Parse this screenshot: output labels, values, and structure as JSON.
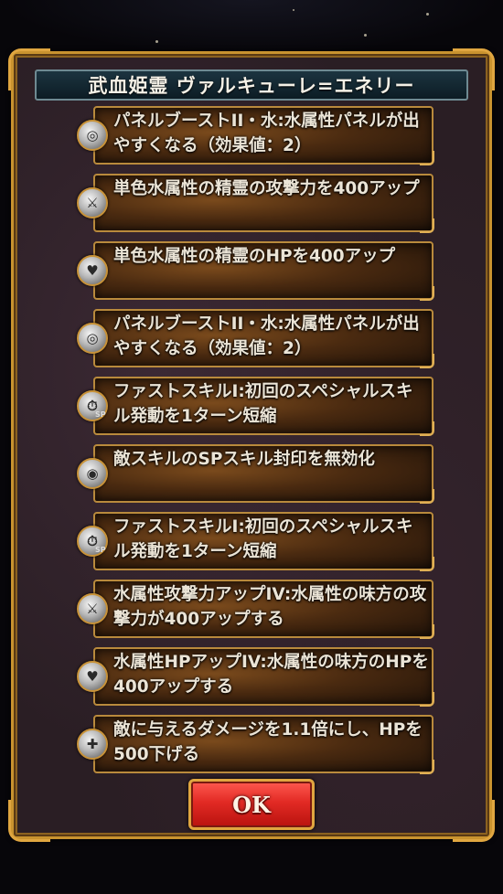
{
  "dialog": {
    "title": "武血姫霊 ヴァルキューレ=エネリー",
    "ok_label": "OK"
  },
  "skills": [
    {
      "icon": "swirl-icon",
      "text": "パネルブーストII・水:水属性パネルが出やすくなる（効果値：2）"
    },
    {
      "icon": "swords-icon",
      "text": "単色水属性の精霊の攻撃力を400アップ"
    },
    {
      "icon": "heart-icon",
      "text": "単色水属性の精霊のHPを400アップ"
    },
    {
      "icon": "swirl-icon",
      "text": "パネルブーストII・水:水属性パネルが出やすくなる（効果値：2）"
    },
    {
      "icon": "fast-skill-icon",
      "sp": "SP",
      "text": "ファストスキルI:初回のスペシャルスキル発動を1ターン短縮"
    },
    {
      "icon": "shield-icon",
      "text": "敵スキルのSPスキル封印を無効化"
    },
    {
      "icon": "fast-skill-icon",
      "sp": "SP",
      "text": "ファストスキルI:初回のスペシャルスキル発動を1ターン短縮"
    },
    {
      "icon": "swords-icon",
      "text": "水属性攻撃力アップIV:水属性の味方の攻撃力が400アップする"
    },
    {
      "icon": "heart-icon",
      "text": "水属性HPアップIV:水属性の味方のHPを400アップする"
    },
    {
      "icon": "swords-heart-icon",
      "text": "敵に与えるダメージを1.1倍にし、HPを500下げる"
    }
  ]
}
